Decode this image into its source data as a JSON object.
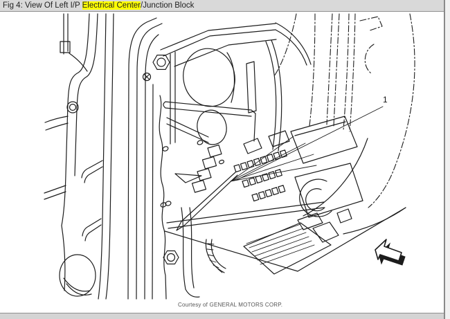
{
  "header": {
    "prefix": "Fig 4: View Of Left I/P ",
    "highlight": "Electrical Center",
    "suffix": "/Junction Block"
  },
  "diagram": {
    "callout_label": "1",
    "caption": "Courtesy of GENERAL MOTORS CORP.",
    "subject": "Left instrument panel electrical center / junction block line drawing",
    "icons": {
      "direction_arrow": "up-left-3d-block-arrow"
    }
  },
  "colors": {
    "titlebar_bg": "#d9d9d9",
    "titlebar_border": "#8f8f8f",
    "highlight": "#ffff00",
    "text": "#222222",
    "line": "#1c1c1c",
    "caption": "#555555",
    "footer_bg": "#d4d4d4",
    "right_border": "#8a8a8a",
    "right_gutter": "#f1f1f1"
  }
}
